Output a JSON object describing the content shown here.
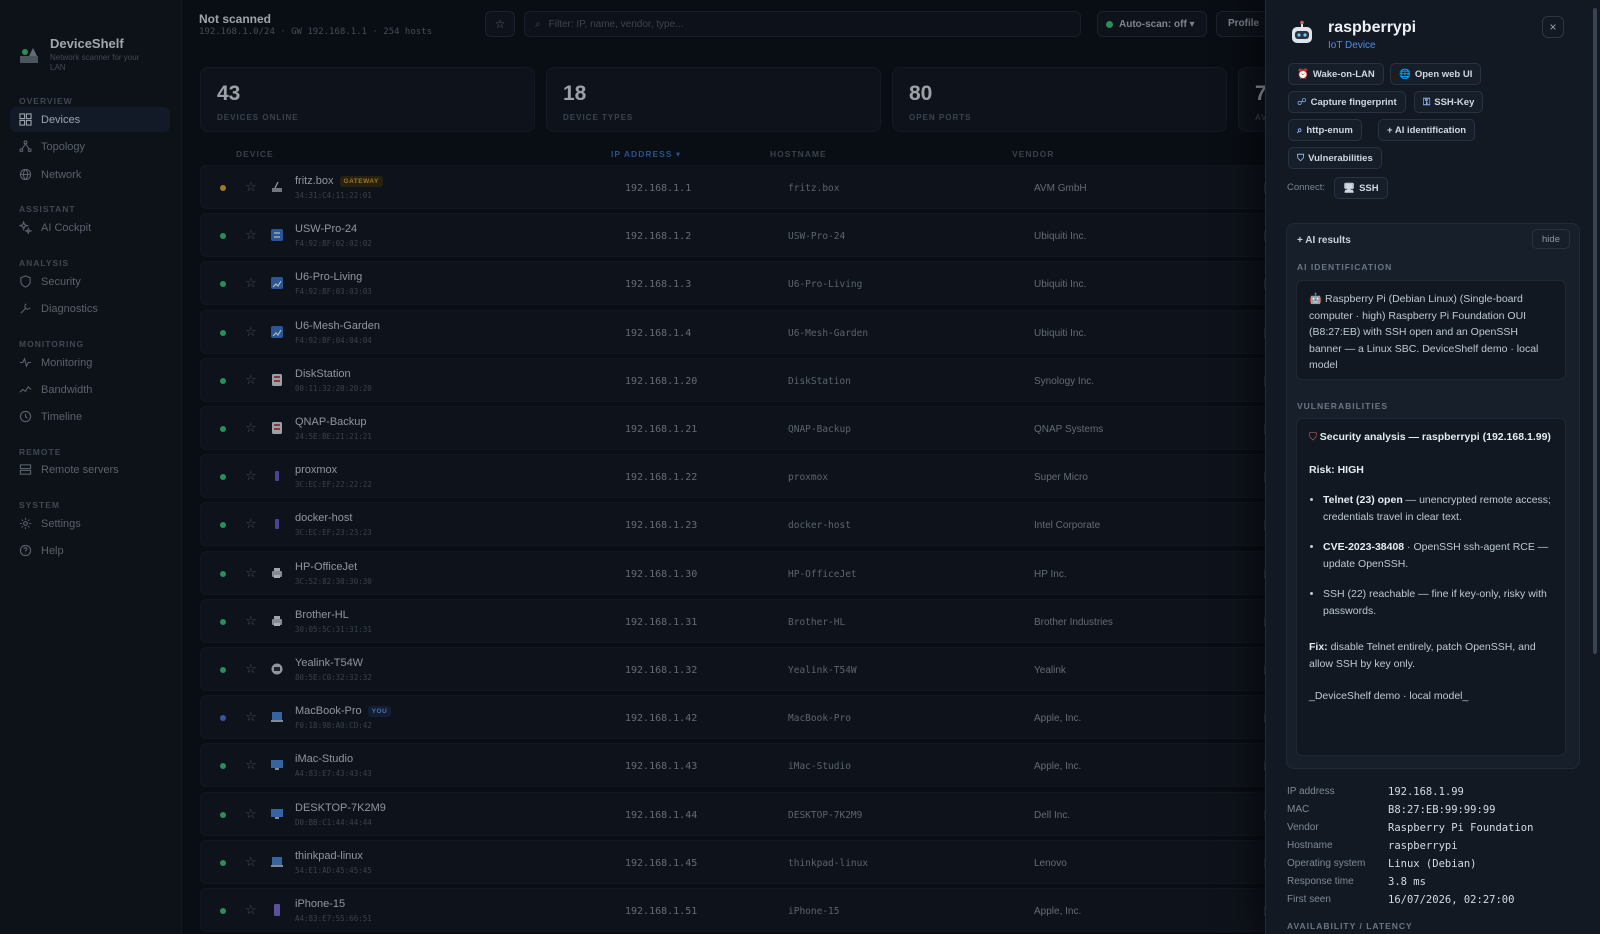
{
  "app": {
    "name": "DeviceShelf",
    "tagline": "Network scanner for your LAN"
  },
  "sidebar": {
    "sections": [
      {
        "label": "OVERVIEW",
        "items": [
          {
            "label": "Devices",
            "icon": "grid-icon",
            "active": true
          },
          {
            "label": "Topology",
            "icon": "topology-icon"
          },
          {
            "label": "Network",
            "icon": "globe-icon"
          }
        ]
      },
      {
        "label": "ASSISTANT",
        "items": [
          {
            "label": "AI Cockpit",
            "icon": "sparkle-icon"
          }
        ]
      },
      {
        "label": "ANALYSIS",
        "items": [
          {
            "label": "Security",
            "icon": "shield-icon"
          },
          {
            "label": "Diagnostics",
            "icon": "wrench-icon"
          }
        ]
      },
      {
        "label": "MONITORING",
        "items": [
          {
            "label": "Monitoring",
            "icon": "pulse-icon"
          },
          {
            "label": "Bandwidth",
            "icon": "bandwidth-icon"
          },
          {
            "label": "Timeline",
            "icon": "clock-icon"
          }
        ]
      },
      {
        "label": "REMOTE",
        "items": [
          {
            "label": "Remote servers",
            "icon": "server-icon"
          }
        ]
      },
      {
        "label": "SYSTEM",
        "items": [
          {
            "label": "Settings",
            "icon": "gear-icon"
          },
          {
            "label": "Help",
            "icon": "help-icon"
          }
        ]
      }
    ]
  },
  "topbar": {
    "status": "Not scanned",
    "subnet": "192.168.1.0/24 · GW 192.168.1.1 · 254 hosts",
    "filter_placeholder": "Filter: IP, name, vendor, type...",
    "autoscan": "Auto-scan: off ▾",
    "profile": "Profile"
  },
  "stats": [
    {
      "value": "43",
      "label": "DEVICES ONLINE"
    },
    {
      "value": "18",
      "label": "DEVICE TYPES"
    },
    {
      "value": "80",
      "label": "OPEN PORTS"
    },
    {
      "value": "7",
      "label": "AV"
    }
  ],
  "table": {
    "headers": {
      "device": "DEVICE",
      "ip": "IP ADDRESS ▾",
      "hostname": "HOSTNAME",
      "vendor": "VENDOR"
    },
    "rows": [
      {
        "name": "fritz.box",
        "badge": "GATEWAY",
        "mac": "34:31:C4:11:22:01",
        "ip": "192.168.1.1",
        "hostname": "fritz.box",
        "vendor": "AVM GmbH",
        "status": "#e0a63a",
        "icon": "router-icon"
      },
      {
        "name": "USW-Pro-24",
        "mac": "F4:92:BF:02:02:02",
        "ip": "192.168.1.2",
        "hostname": "USW-Pro-24",
        "vendor": "Ubiquiti Inc.",
        "status": "#3cc47c",
        "icon": "switch-icon"
      },
      {
        "name": "U6-Pro-Living",
        "mac": "F4:92:BF:03:03:03",
        "ip": "192.168.1.3",
        "hostname": "U6-Pro-Living",
        "vendor": "Ubiquiti Inc.",
        "status": "#3cc47c",
        "icon": "access-point-icon"
      },
      {
        "name": "U6-Mesh-Garden",
        "mac": "F4:92:BF:04:04:04",
        "ip": "192.168.1.4",
        "hostname": "U6-Mesh-Garden",
        "vendor": "Ubiquiti Inc.",
        "status": "#3cc47c",
        "icon": "access-point-icon"
      },
      {
        "name": "DiskStation",
        "mac": "00:11:32:20:20:20",
        "ip": "192.168.1.20",
        "hostname": "DiskStation",
        "vendor": "Synology Inc.",
        "status": "#3cc47c",
        "icon": "nas-icon"
      },
      {
        "name": "QNAP-Backup",
        "mac": "24:5E:BE:21:21:21",
        "ip": "192.168.1.21",
        "hostname": "QNAP-Backup",
        "vendor": "QNAP Systems",
        "status": "#3cc47c",
        "icon": "nas-icon"
      },
      {
        "name": "proxmox",
        "mac": "3C:EC:EF:22:22:22",
        "ip": "192.168.1.22",
        "hostname": "proxmox",
        "vendor": "Super Micro",
        "status": "#3cc47c",
        "icon": "server-icon"
      },
      {
        "name": "docker-host",
        "mac": "3C:EC:EF:23:23:23",
        "ip": "192.168.1.23",
        "hostname": "docker-host",
        "vendor": "Intel Corporate",
        "status": "#3cc47c",
        "icon": "server-icon"
      },
      {
        "name": "HP-OfficeJet",
        "mac": "3C:52:82:30:30:30",
        "ip": "192.168.1.30",
        "hostname": "HP-OfficeJet",
        "vendor": "HP Inc.",
        "status": "#3cc47c",
        "icon": "printer-icon"
      },
      {
        "name": "Brother-HL",
        "mac": "30:05:5C:31:31:31",
        "ip": "192.168.1.31",
        "hostname": "Brother-HL",
        "vendor": "Brother Industries",
        "status": "#3cc47c",
        "icon": "printer-icon"
      },
      {
        "name": "Yealink-T54W",
        "mac": "80:5E:C0:32:32:32",
        "ip": "192.168.1.32",
        "hostname": "Yealink-T54W",
        "vendor": "Yealink",
        "status": "#3cc47c",
        "icon": "phone-icon"
      },
      {
        "name": "MacBook-Pro",
        "badge": "YOU",
        "mac": "F0:18:98:A0:CD:42",
        "ip": "192.168.1.42",
        "hostname": "MacBook-Pro",
        "vendor": "Apple, Inc.",
        "status": "#4a78e0",
        "icon": "laptop-icon"
      },
      {
        "name": "iMac-Studio",
        "mac": "A4:83:E7:43:43:43",
        "ip": "192.168.1.43",
        "hostname": "iMac-Studio",
        "vendor": "Apple, Inc.",
        "status": "#3cc47c",
        "icon": "desktop-icon"
      },
      {
        "name": "DESKTOP-7K2M9",
        "mac": "D0:BB:C1:44:44:44",
        "ip": "192.168.1.44",
        "hostname": "DESKTOP-7K2M9",
        "vendor": "Dell Inc.",
        "status": "#3cc47c",
        "icon": "desktop-icon"
      },
      {
        "name": "thinkpad-linux",
        "mac": "54:E1:AD:45:45:45",
        "ip": "192.168.1.45",
        "hostname": "thinkpad-linux",
        "vendor": "Lenovo",
        "status": "#3cc47c",
        "icon": "laptop-icon"
      },
      {
        "name": "iPhone-15",
        "mac": "A4:83:E7:55:66:51",
        "ip": "192.168.1.51",
        "hostname": "iPhone-15",
        "vendor": "Apple, Inc.",
        "status": "#3cc47c",
        "icon": "smartphone-icon"
      }
    ]
  },
  "panel": {
    "title": "raspberrypi",
    "type": "IoT Device",
    "close": "×",
    "actions": [
      {
        "label": "Wake-on-LAN",
        "icon": "alarm-icon",
        "glyph": "⏰"
      },
      {
        "label": "Open web UI",
        "icon": "globe-icon",
        "glyph": "🌐"
      },
      {
        "label": "Capture fingerprint",
        "icon": "fingerprint-icon",
        "glyph": "☍"
      },
      {
        "label": "SSH-Key",
        "icon": "key-icon",
        "glyph": "⚿"
      },
      {
        "label": "http-enum",
        "icon": "magnifier-icon",
        "glyph": "⌕"
      },
      {
        "label": "+ AI identification",
        "icon": "",
        "glyph": ""
      },
      {
        "label": "Vulnerabilities",
        "icon": "shield-icon",
        "glyph": "⛉"
      }
    ],
    "connect_label": "Connect:",
    "connect_ssh": "SSH",
    "ai": {
      "header": "+ AI results",
      "hide": "hide",
      "ident_label": "AI IDENTIFICATION",
      "ident_text": "Raspberry Pi (Debian Linux) (Single-board computer · high) Raspberry Pi Foundation OUI (B8:27:EB) with SSH open and an OpenSSH banner — a Linux SBC. DeviceShelf demo · local model",
      "vuln_label": "VULNERABILITIES",
      "vuln_title": "Security analysis — raspberrypi (192.168.1.99)",
      "risk": "Risk: HIGH",
      "b1_strong": "Telnet (23) open",
      "b1_text": " — unencrypted remote access; credentials travel in clear text.",
      "b2_strong": "CVE-2023-38408",
      "b2_text": " · OpenSSH ssh-agent RCE — update OpenSSH.",
      "b3_text": "SSH (22) reachable — fine if key-only, risky with passwords.",
      "fix_strong": "Fix:",
      "fix_text": " disable Telnet entirely, patch OpenSSH, and allow SSH by key only.",
      "footer": "_DeviceShelf demo · local model_"
    },
    "details": [
      {
        "k": "IP address",
        "v": "192.168.1.99"
      },
      {
        "k": "MAC",
        "v": "B8:27:EB:99:99:99"
      },
      {
        "k": "Vendor",
        "v": "Raspberry Pi Foundation"
      },
      {
        "k": "Hostname",
        "v": "raspberrypi"
      },
      {
        "k": "Operating system",
        "v": "Linux (Debian)"
      },
      {
        "k": "Response time",
        "v": "3.8 ms"
      },
      {
        "k": "First seen",
        "v": "16/07/2026, 02:27:00"
      }
    ],
    "avail_label": "AVAILABILITY / LATENCY"
  },
  "colors": {
    "accent": "#4f8de6",
    "online": "#3cc47c",
    "gateway": "#e0a63a",
    "you": "#4a78e0"
  }
}
